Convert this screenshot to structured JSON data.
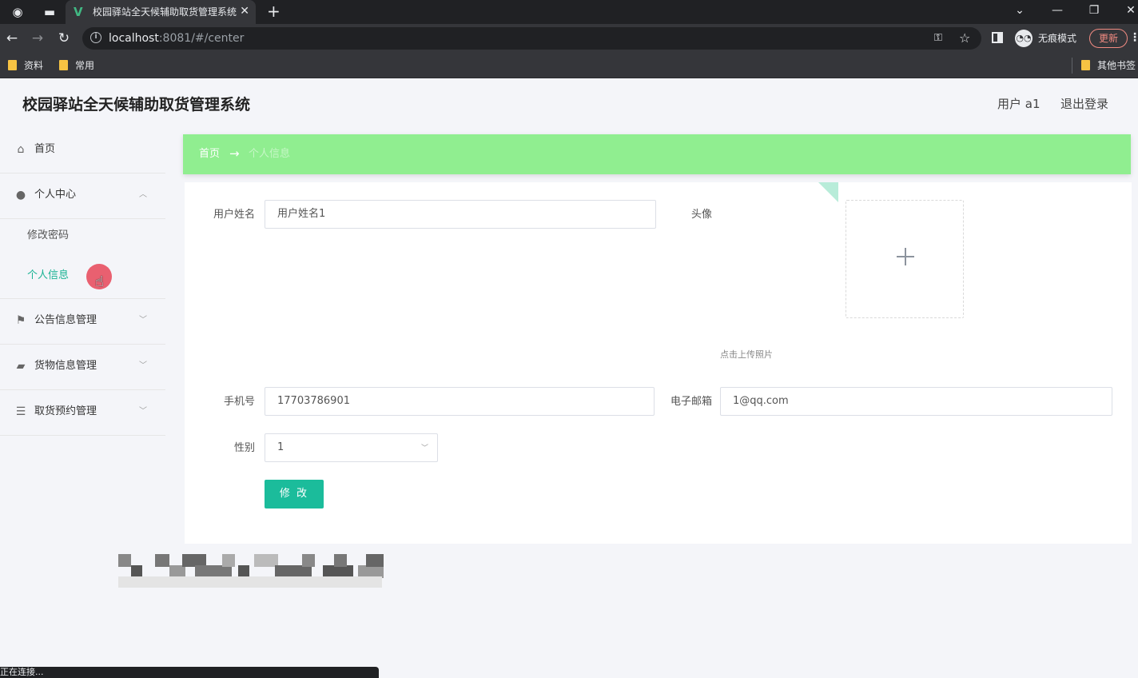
{
  "browser": {
    "tab_title": "校园驿站全天候辅助取货管理系统",
    "url_host": "localhost",
    "url_rest": ":8081/#/center",
    "incognito_label": "无痕模式",
    "update_label": "更新",
    "bookmarks": [
      "资料",
      "常用"
    ],
    "other_bookmarks": "其他书签",
    "status_text": "正在连接..."
  },
  "header": {
    "title": "校园驿站全天候辅助取货管理系统",
    "user_label": "用户 a1",
    "logout_label": "退出登录"
  },
  "sidebar": {
    "home": "首页",
    "personal_center": "个人中心",
    "change_password": "修改密码",
    "personal_info": "个人信息",
    "notice_mgmt": "公告信息管理",
    "goods_mgmt": "货物信息管理",
    "pickup_mgmt": "取货预约管理"
  },
  "breadcrumb": {
    "home": "首页",
    "arrow": "→",
    "current": "个人信息"
  },
  "form": {
    "username_label": "用户姓名",
    "username_value": "用户姓名1",
    "avatar_label": "头像",
    "upload_tip": "点击上传照片",
    "phone_label": "手机号",
    "phone_value": "17703786901",
    "email_label": "电子邮箱",
    "email_value": "1@qq.com",
    "gender_label": "性别",
    "gender_value": "1",
    "submit_label": "修 改"
  },
  "colors": {
    "accent": "#1bbc9b",
    "breadcrumb_bg": "#90ee90",
    "active_menu": "#1bb394"
  }
}
